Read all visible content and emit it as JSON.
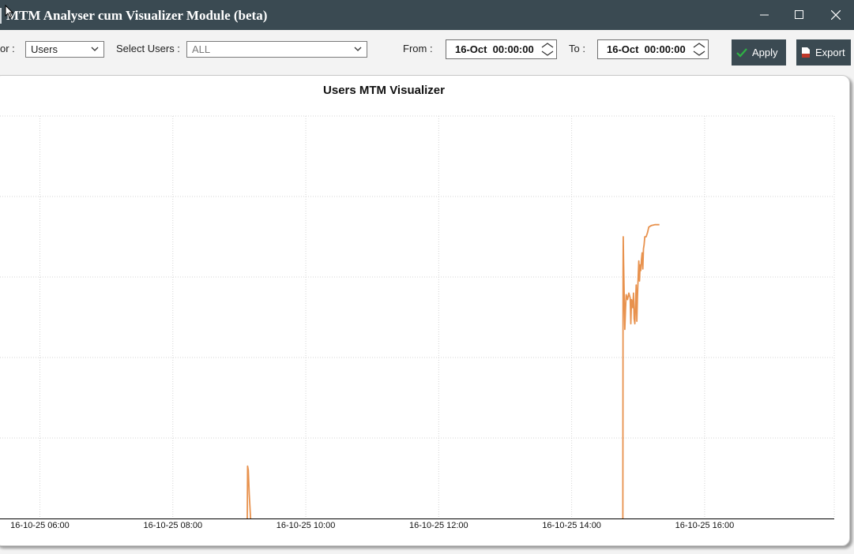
{
  "window": {
    "title": "MTM Analyser cum Visualizer Module (beta)",
    "controls": [
      "minimize-icon",
      "maximize-icon",
      "close-icon"
    ]
  },
  "toolbar": {
    "filter_label_fragment": "or :",
    "filter_value": "Users",
    "select_users_label": "Select Users :",
    "select_users_value": "ALL",
    "from_label": "From :",
    "from_value": "16-Oct  00:00:00",
    "to_label": "To :",
    "to_value": "16-Oct  00:00:00",
    "apply_label": "Apply",
    "export_label": "Export"
  },
  "colors": {
    "titlebar": "#3a4a52",
    "button_bg": "#3b4a52",
    "series_line": "#e8924e",
    "apply_check": "#2fb344",
    "export_icon": "#c0392b"
  },
  "chart_data": {
    "type": "line",
    "title": "Users MTM Visualizer",
    "xlabel": "",
    "ylabel": "",
    "x_tick_labels": [
      "16-10-25 06:00",
      "16-10-25 08:00",
      "16-10-25 10:00",
      "16-10-25 12:00",
      "16-10-25 14:00",
      "16-10-25 16:00"
    ],
    "x_tick_hours": [
      6,
      8,
      10,
      12,
      14,
      16
    ],
    "xlim_hours": [
      5.4,
      17.95
    ],
    "ylim": [
      0,
      5
    ],
    "y_gridlines": [
      1,
      2,
      3,
      4,
      5
    ],
    "grid": true,
    "legend": "none",
    "series": [
      {
        "values": [
          [
            9.12,
            0.0
          ],
          [
            9.125,
            0.65
          ],
          [
            9.135,
            0.6
          ],
          [
            9.15,
            0.3
          ],
          [
            9.17,
            0.0
          ]
        ]
      },
      {
        "values": [
          [
            14.77,
            0.0
          ],
          [
            14.773,
            3.1
          ],
          [
            14.776,
            3.5
          ],
          [
            14.78,
            3.22
          ],
          [
            14.79,
            2.78
          ],
          [
            14.8,
            2.35
          ],
          [
            14.81,
            2.6
          ],
          [
            14.82,
            2.78
          ],
          [
            14.84,
            2.72
          ],
          [
            14.86,
            2.8
          ],
          [
            14.88,
            2.74
          ],
          [
            14.89,
            2.42
          ],
          [
            14.9,
            2.72
          ],
          [
            14.92,
            2.62
          ],
          [
            14.93,
            2.8
          ],
          [
            14.94,
            2.48
          ],
          [
            14.95,
            2.42
          ],
          [
            14.96,
            2.65
          ],
          [
            14.97,
            2.9
          ],
          [
            14.98,
            2.45
          ],
          [
            14.99,
            2.75
          ],
          [
            15.0,
            3.0
          ],
          [
            15.01,
            3.2
          ],
          [
            15.02,
            2.95
          ],
          [
            15.03,
            3.15
          ],
          [
            15.04,
            3.08
          ],
          [
            15.05,
            3.22
          ],
          [
            15.06,
            3.3
          ],
          [
            15.07,
            3.1
          ],
          [
            15.08,
            3.35
          ],
          [
            15.09,
            3.4
          ],
          [
            15.1,
            3.5
          ],
          [
            15.12,
            3.5
          ],
          [
            15.14,
            3.55
          ],
          [
            15.16,
            3.62
          ],
          [
            15.2,
            3.64
          ],
          [
            15.25,
            3.65
          ],
          [
            15.32,
            3.65
          ]
        ]
      }
    ]
  }
}
